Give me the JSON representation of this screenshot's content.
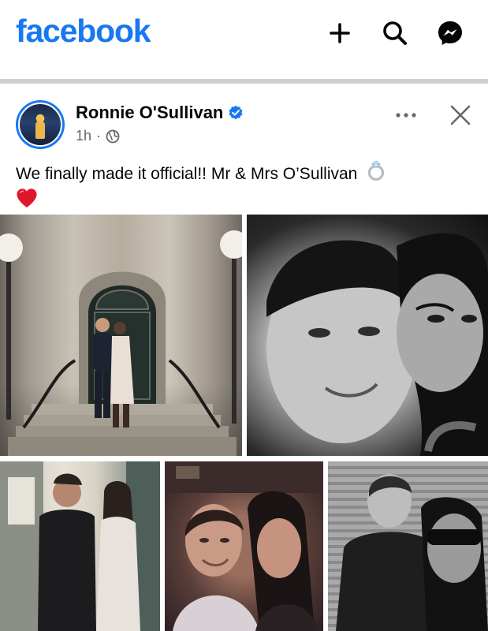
{
  "app": {
    "logo": "facebook",
    "brand_color": "#1877f2",
    "header_icons": [
      "plus-icon",
      "search-icon",
      "messenger-icon"
    ]
  },
  "post": {
    "author": "Ronnie O'Sullivan",
    "verified": true,
    "time": "1h",
    "time_separator": "·",
    "audience_icon": "globe-icon",
    "caption": "We finally made it official!! Mr & Mrs O’Sullivan",
    "caption_emojis": [
      "ring-emoji",
      "heart-emoji"
    ],
    "photo_count": 5
  }
}
